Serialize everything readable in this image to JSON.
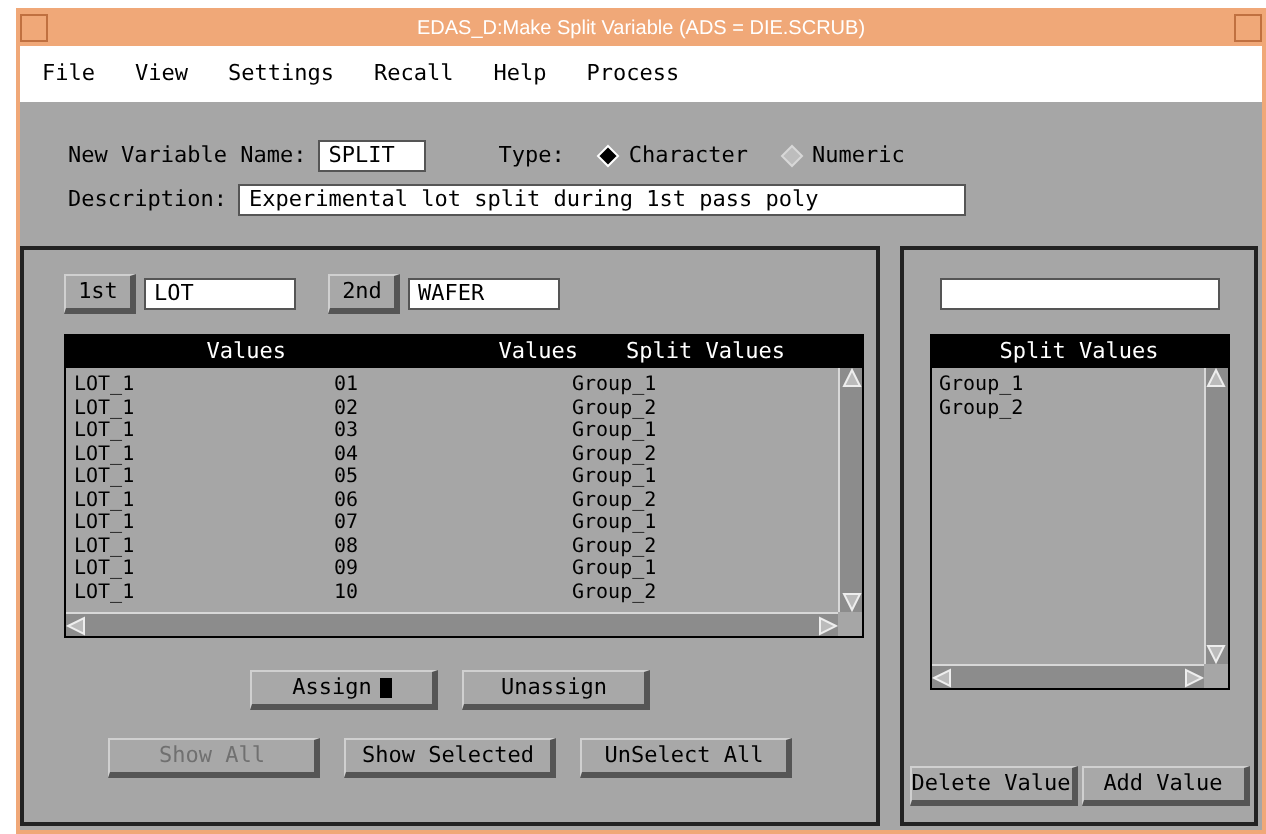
{
  "window": {
    "title": "EDAS_D:Make Split Variable  (ADS = DIE.SCRUB)"
  },
  "menu": [
    "File",
    "View",
    "Settings",
    "Recall",
    "Help",
    "Process"
  ],
  "form": {
    "name_label": "New Variable Name:",
    "name_value": "SPLIT",
    "type_label": "Type:",
    "types": [
      {
        "label": "Character",
        "selected": true
      },
      {
        "label": "Numeric",
        "selected": false
      }
    ],
    "description_label": "Description:",
    "description_value": "Experimental lot split during 1st pass poly"
  },
  "left": {
    "first_button": "1st",
    "first_value": "LOT",
    "second_button": "2nd",
    "second_value": "WAFER",
    "table": {
      "columns": [
        "Values",
        "Values",
        "Split Values"
      ],
      "rows": [
        [
          "LOT_1",
          "01",
          "Group_1"
        ],
        [
          "LOT_1",
          "02",
          "Group_2"
        ],
        [
          "LOT_1",
          "03",
          "Group_1"
        ],
        [
          "LOT_1",
          "04",
          "Group_2"
        ],
        [
          "LOT_1",
          "05",
          "Group_1"
        ],
        [
          "LOT_1",
          "06",
          "Group_2"
        ],
        [
          "LOT_1",
          "07",
          "Group_1"
        ],
        [
          "LOT_1",
          "08",
          "Group_2"
        ],
        [
          "LOT_1",
          "09",
          "Group_1"
        ],
        [
          "LOT_1",
          "10",
          "Group_2"
        ]
      ]
    },
    "assign_buttons": [
      {
        "label": "Assign",
        "disabled": false
      },
      {
        "label": "Unassign",
        "disabled": false
      }
    ],
    "buttons": [
      {
        "label": "Show All",
        "disabled": true
      },
      {
        "label": "Show Selected",
        "disabled": false
      },
      {
        "label": "UnSelect All",
        "disabled": false
      }
    ]
  },
  "right": {
    "list": {
      "title": "Split Values",
      "items": [
        "Group_1",
        "Group_2"
      ]
    },
    "buttons": [
      {
        "label": "Delete Value",
        "disabled": false
      },
      {
        "label": "Add Value",
        "disabled": false
      }
    ]
  }
}
